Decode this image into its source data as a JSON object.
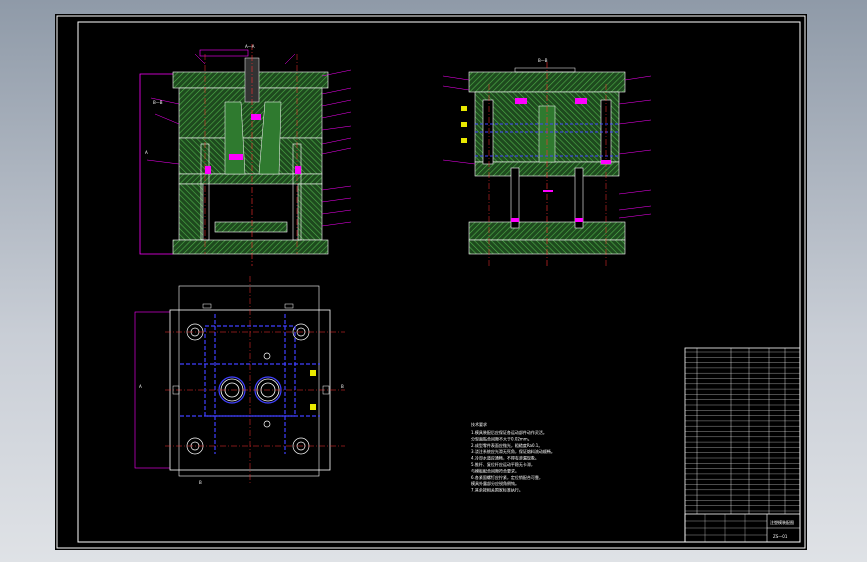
{
  "drawing": {
    "section_labels": {
      "left_top_1": "A—A",
      "left_side": "B—B",
      "right_title": "B—B",
      "arrow_a": "A",
      "arrow_b": "B",
      "plan_left": "A",
      "plan_right": "B",
      "plan_bottom": "B"
    },
    "colors": {
      "background": "#000000",
      "frame": "#ffffff",
      "hatch": "#3d9a3a",
      "leader": "#ff00ff",
      "centerline": "#ff3030",
      "hidden": "#4040ff",
      "fill": "#2b5e2b",
      "yellow": "#e8e800"
    },
    "notes_title": "技术要求",
    "notes_lines": [
      "1.模具装配后应保证各运动部件动作灵活。",
      "  分型面贴合间隙不大于0.02mm。",
      "2.成型零件表面应抛光，粗糙度Ra0.1。",
      "3.浇注系统应光滑无死角，保证熔料流动顺畅。",
      "4.冷却水道应通畅，不得有渗漏现象。",
      "5.推杆、复位杆应运动平稳无卡滞，",
      "  与模板配合间隙符合要求。",
      "6.各紧固螺钉应拧紧，定位销配合可靠，",
      "  模具外露部分应锐角倒钝。",
      "7.其余按相关国家标准执行。"
    ],
    "title_block": {
      "title": "注塑模装配图",
      "drawing_no": "ZS—01"
    }
  }
}
